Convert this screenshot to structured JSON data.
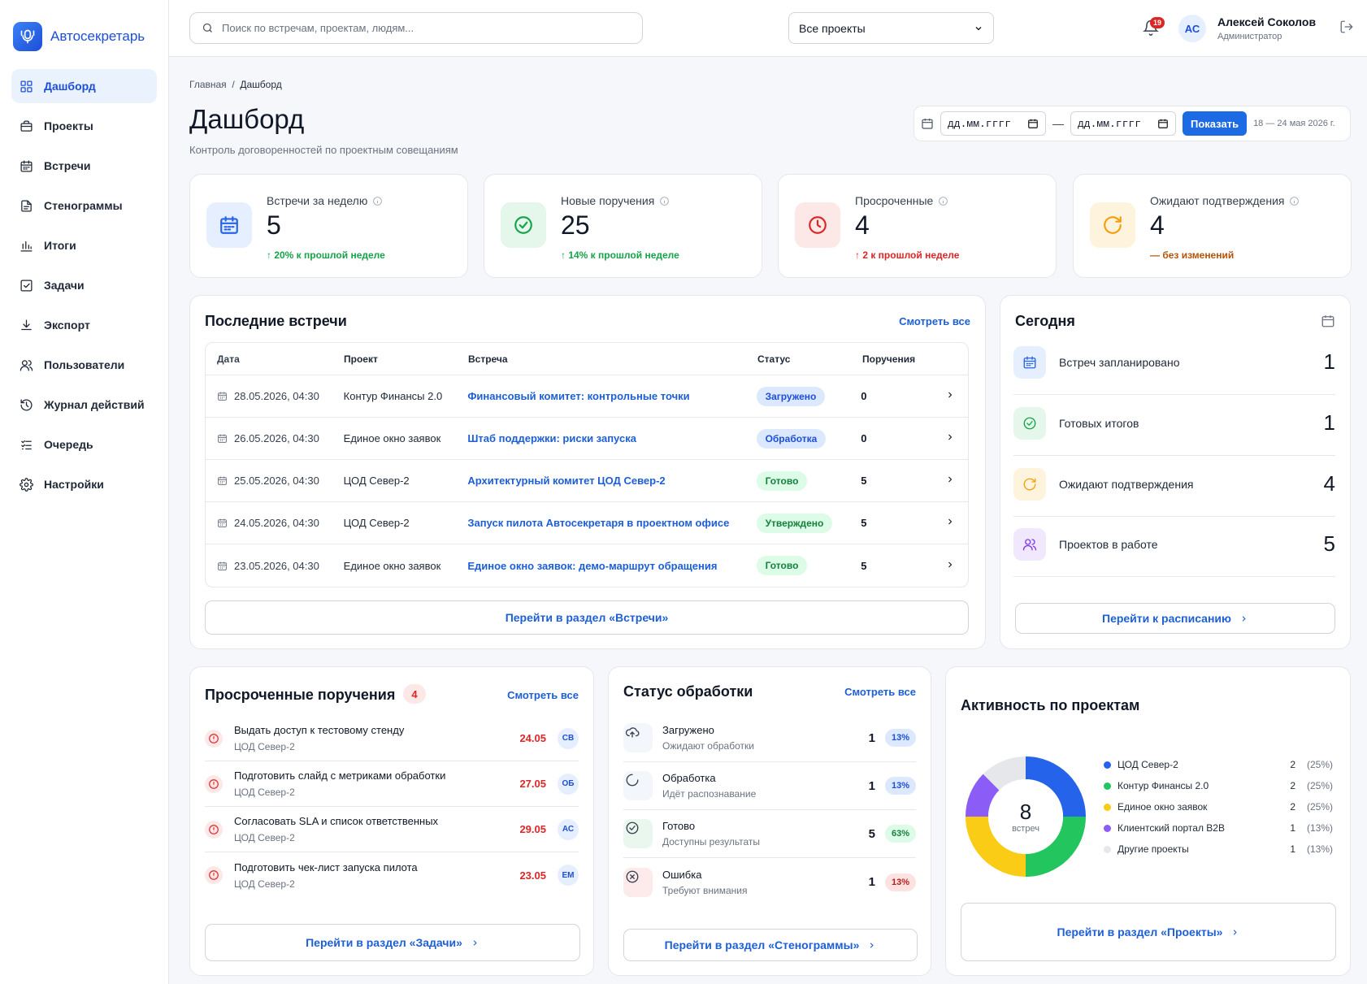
{
  "app": {
    "name": "Автосекретарь"
  },
  "sidebar": {
    "items": [
      {
        "label": "Дашборд",
        "icon": "dashboard-icon",
        "active": true
      },
      {
        "label": "Проекты",
        "icon": "briefcase-icon"
      },
      {
        "label": "Встречи",
        "icon": "calendar-icon"
      },
      {
        "label": "Стенограммы",
        "icon": "document-icon"
      },
      {
        "label": "Итоги",
        "icon": "bar-chart-icon"
      },
      {
        "label": "Задачи",
        "icon": "checkbox-icon"
      },
      {
        "label": "Экспорт",
        "icon": "download-icon"
      },
      {
        "label": "Пользователи",
        "icon": "users-icon"
      },
      {
        "label": "Журнал действий",
        "icon": "history-icon"
      },
      {
        "label": "Очередь",
        "icon": "queue-icon"
      },
      {
        "label": "Настройки",
        "icon": "gear-icon"
      }
    ]
  },
  "topbar": {
    "search_placeholder": "Поиск по встречам, проектам, людям...",
    "project_filter": "Все проекты",
    "notifications_count": "19",
    "user": {
      "initials": "АС",
      "name": "Алексей Соколов",
      "role": "Администратор"
    }
  },
  "header": {
    "breadcrumb_home": "Главная",
    "breadcrumb_sep": "/",
    "breadcrumb_current": "Дашборд",
    "title": "Дашборд",
    "subtitle": "Контроль договоренностей по проектным совещаниям",
    "date_from_placeholder": "дд.мм.гггг",
    "date_to_placeholder": "дд.мм.гггг",
    "date_dash": "—",
    "show_button": "Показать",
    "range_text": "18 — 24 мая 2026 г."
  },
  "kpis": [
    {
      "label": "Встречи за неделю",
      "value": "5",
      "trend": "↑ 20% к прошлой неделе",
      "color": "#2563eb",
      "bg": "#e6efff",
      "trend_color": "#16a34a",
      "icon": "calendar-icon"
    },
    {
      "label": "Новые поручения",
      "value": "25",
      "trend": "↑ 14% к прошлой неделе",
      "color": "#16a34a",
      "bg": "#e4f7ea",
      "trend_color": "#16a34a",
      "icon": "check-circle-icon"
    },
    {
      "label": "Просроченные",
      "value": "4",
      "trend": "↑ 2 к прошлой неделе",
      "color": "#dc2626",
      "bg": "#fde8e8",
      "trend_color": "#dc2626",
      "icon": "clock-icon"
    },
    {
      "label": "Ожидают подтверждения",
      "value": "4",
      "trend": "— без изменений",
      "color": "#f59e0b",
      "bg": "#fef3dc",
      "trend_color": "#b45309",
      "icon": "refresh-icon"
    }
  ],
  "meetings": {
    "title": "Последние встречи",
    "view_all": "Смотреть все",
    "columns": [
      "Дата",
      "Проект",
      "Встреча",
      "Статус",
      "Поручения"
    ],
    "rows": [
      {
        "date": "28.05.2026, 04:30",
        "project": "Контур Финансы 2.0",
        "meeting": "Финансовый комитет: контрольные точки",
        "status": "Загружено",
        "status_kind": "blue",
        "tasks": "0"
      },
      {
        "date": "26.05.2026, 04:30",
        "project": "Единое окно заявок",
        "meeting": "Штаб поддержки: риски запуска",
        "status": "Обработка",
        "status_kind": "blue",
        "tasks": "0"
      },
      {
        "date": "25.05.2026, 04:30",
        "project": "ЦОД Север-2",
        "meeting": "Архитектурный комитет ЦОД Север-2",
        "status": "Готово",
        "status_kind": "green",
        "tasks": "5"
      },
      {
        "date": "24.05.2026, 04:30",
        "project": "ЦОД Север-2",
        "meeting": "Запуск пилота Автосекретаря в проектном офисе",
        "status": "Утверждено",
        "status_kind": "green",
        "tasks": "5"
      },
      {
        "date": "23.05.2026, 04:30",
        "project": "Единое окно заявок",
        "meeting": "Единое окно заявок: демо-маршрут обращения",
        "status": "Готово",
        "status_kind": "green",
        "tasks": "5"
      }
    ],
    "goto": "Перейти в раздел «Встречи»"
  },
  "today": {
    "title": "Сегодня",
    "items": [
      {
        "label": "Встреч запланировано",
        "value": "1",
        "color": "#2563eb",
        "bg": "#e6efff",
        "icon": "calendar-icon"
      },
      {
        "label": "Готовых итогов",
        "value": "1",
        "color": "#16a34a",
        "bg": "#e4f7ea",
        "icon": "check-circle-icon"
      },
      {
        "label": "Ожидают подтверждения",
        "value": "4",
        "color": "#f59e0b",
        "bg": "#fef3dc",
        "icon": "refresh-icon"
      },
      {
        "label": "Проектов в работе",
        "value": "5",
        "color": "#7c3aed",
        "bg": "#f1e8fd",
        "icon": "users-icon"
      }
    ],
    "goto": "Перейти к расписанию"
  },
  "overdue": {
    "title": "Просроченные поручения",
    "count": "4",
    "view_all": "Смотреть все",
    "items": [
      {
        "title": "Выдать доступ к тестовому стенду",
        "project": "ЦОД Север-2",
        "date": "24.05",
        "assignee": "СВ"
      },
      {
        "title": "Подготовить слайд с метриками обработки",
        "project": "ЦОД Север-2",
        "date": "27.05",
        "assignee": "ОБ"
      },
      {
        "title": "Согласовать SLA и список ответственных",
        "project": "ЦОД Север-2",
        "date": "29.05",
        "assignee": "АС"
      },
      {
        "title": "Подготовить чек-лист запуска пилота",
        "project": "ЦОД Север-2",
        "date": "23.05",
        "assignee": "ЕМ"
      }
    ],
    "goto": "Перейти в раздел «Задачи»"
  },
  "processing": {
    "title": "Статус обработки",
    "view_all": "Смотреть все",
    "items": [
      {
        "title": "Загружено",
        "sub": "Ожидают обработки",
        "count": "1",
        "pct": "13%",
        "pct_color": "#1d4ed8",
        "pct_bg": "#dbe8fd",
        "icon": "upload-cloud-icon",
        "icon_color": "#374151"
      },
      {
        "title": "Обработка",
        "sub": "Идёт распознавание",
        "count": "1",
        "pct": "13%",
        "pct_color": "#1d4ed8",
        "pct_bg": "#dbe8fd",
        "icon": "spinner-icon",
        "icon_color": "#374151"
      },
      {
        "title": "Готово",
        "sub": "Доступны результаты",
        "count": "5",
        "pct": "63%",
        "pct_color": "#15803d",
        "pct_bg": "#dcfce7",
        "icon": "check-circle-icon",
        "icon_color": "#374151"
      },
      {
        "title": "Ошибка",
        "sub": "Требуют внимания",
        "count": "1",
        "pct": "13%",
        "pct_color": "#b91c1c",
        "pct_bg": "#fde2e2",
        "icon": "x-circle-icon",
        "icon_color": "#374151"
      }
    ],
    "goto": "Перейти в раздел «Стенограммы»"
  },
  "activity": {
    "title": "Активность по проектам",
    "total": "8",
    "total_label": "встреч",
    "goto": "Перейти в раздел «Проекты»"
  },
  "chart_data": {
    "type": "pie",
    "categories": [
      "ЦОД Север-2",
      "Контур Финансы 2.0",
      "Единое окно заявок",
      "Клиентский портал B2B",
      "Другие проекты"
    ],
    "values": [
      2,
      2,
      2,
      1,
      1
    ],
    "percent_labels": [
      "(25%)",
      "(25%)",
      "(25%)",
      "(13%)",
      "(13%)"
    ],
    "colors": [
      "#2563eb",
      "#22c55e",
      "#facc15",
      "#8b5cf6",
      "#e5e7eb"
    ]
  }
}
